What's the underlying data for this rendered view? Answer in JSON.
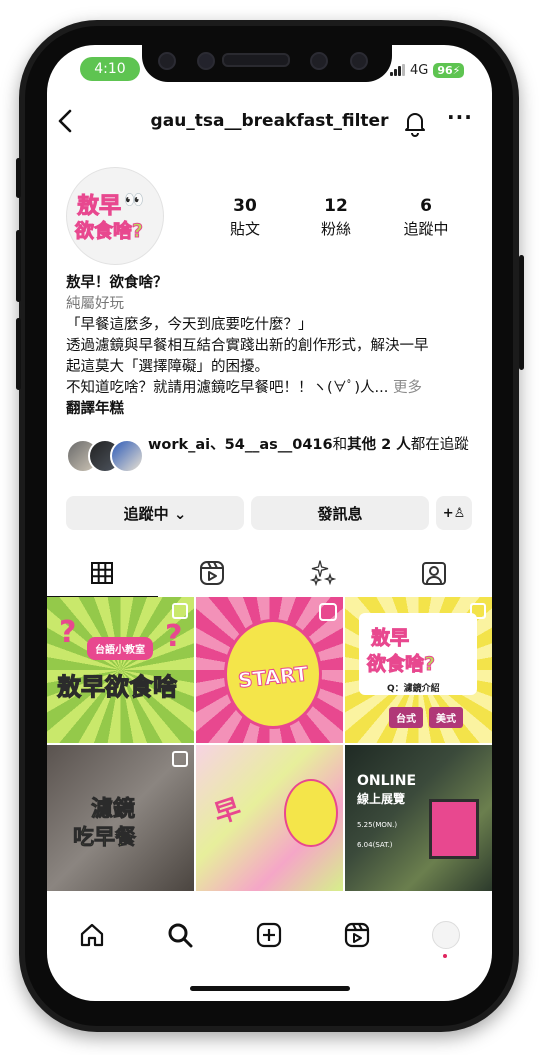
{
  "status_bar": {
    "time": "4:10",
    "network": "4G",
    "battery": "96"
  },
  "header": {
    "back_label": "<",
    "username": "gau_tsa__breakfast_filter",
    "more_label": "···"
  },
  "profile": {
    "avatar_line1": "敖早",
    "avatar_eyes": "👀",
    "avatar_line2": "欲食啥?",
    "stats": [
      {
        "value": "30",
        "label": "貼文"
      },
      {
        "value": "12",
        "label": "粉絲"
      },
      {
        "value": "6",
        "label": "追蹤中"
      }
    ]
  },
  "bio": {
    "name": "敖早！欲食啥？",
    "category": "純屬好玩",
    "line1": "「早餐這麼多，今天到底要吃什麼？」",
    "line2": "透過濾鏡與早餐相互結合實踐出新的創作形式，解決一早",
    "line3": "起這莫大「選擇障礙」的困擾。",
    "line4": "不知道吃啥？就請用濾鏡吃早餐吧！！ヽ(∀ﾟ)人...",
    "more": " 更多",
    "translate": "翻譯年糕"
  },
  "followed_by": {
    "names": "work_ai、54__as__0416",
    "connector": "和",
    "others": "其他 2 人",
    "suffix": "都在追蹤"
  },
  "actions": {
    "following": "追蹤中 ⌄",
    "message": "發訊息",
    "add_user": "+♙"
  },
  "grid": {
    "post1": {
      "badge": "台語小教室",
      "title": "敖早欲食啥",
      "q1": "?",
      "q2": "?"
    },
    "post2": {
      "label": "START"
    },
    "post3": {
      "line1": "敖早",
      "line2": "欲食啥?",
      "sub": "Q：濾鏡介紹",
      "tag1": "台式",
      "tag2": "美式"
    },
    "post4": {
      "line1": "濾鏡",
      "line2": "吃早餐"
    },
    "post5": {
      "label": "早"
    },
    "post6": {
      "line1": "ONLINE",
      "line2": "線上展覽",
      "date1": "5.25(MON.)",
      "date2": "6.04(SAT.)"
    }
  },
  "colors": {
    "accent_green": "#5ec451",
    "brand_pink": "#e8488f",
    "brand_yellow": "#f3e34a",
    "brand_lime": "#c9e86b"
  }
}
